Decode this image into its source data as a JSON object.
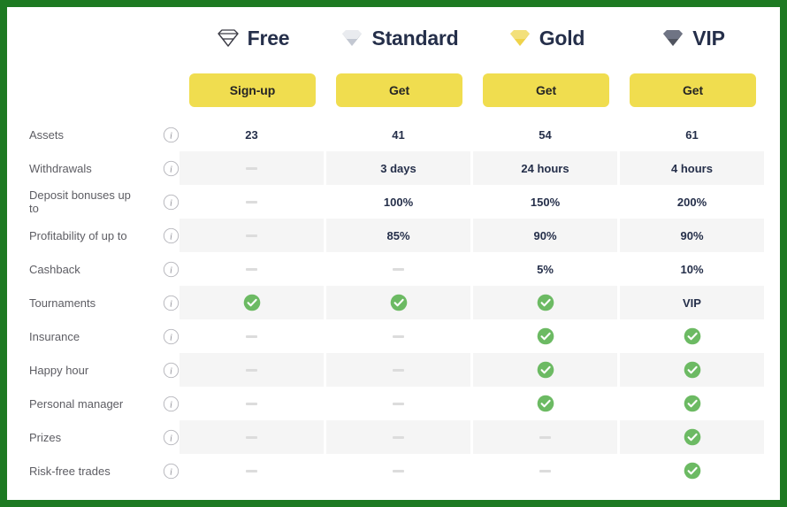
{
  "colors": {
    "frame_border": "#1d7a22",
    "button": "#f0dd4f",
    "check": "#6cba63",
    "stripe": "#f5f5f5",
    "heading_text": "#252f4a",
    "label_text": "#5d5d63"
  },
  "plans": [
    {
      "name": "Free",
      "icon": "gem-outline-icon",
      "cta": "Sign-up"
    },
    {
      "name": "Standard",
      "icon": "gem-silver-icon",
      "cta": "Get"
    },
    {
      "name": "Gold",
      "icon": "gem-gold-icon",
      "cta": "Get"
    },
    {
      "name": "VIP",
      "icon": "gem-black-icon",
      "cta": "Get"
    }
  ],
  "info_icon": "info-circle-icon",
  "rows": [
    {
      "label": "Assets",
      "striped": false,
      "values": [
        "23",
        "41",
        "54",
        "61"
      ],
      "types": [
        "text",
        "text",
        "text",
        "text"
      ]
    },
    {
      "label": "Withdrawals",
      "striped": true,
      "values": [
        "",
        "3 days",
        "24 hours",
        "4 hours"
      ],
      "types": [
        "dash",
        "text",
        "text",
        "text"
      ]
    },
    {
      "label": "Deposit bonuses up to",
      "striped": false,
      "values": [
        "",
        "100%",
        "150%",
        "200%"
      ],
      "types": [
        "dash",
        "text",
        "text",
        "text"
      ]
    },
    {
      "label": "Profitability of up to",
      "striped": true,
      "values": [
        "",
        "85%",
        "90%",
        "90%"
      ],
      "types": [
        "dash",
        "text",
        "text",
        "text"
      ]
    },
    {
      "label": "Cashback",
      "striped": false,
      "values": [
        "",
        "",
        "5%",
        "10%"
      ],
      "types": [
        "dash",
        "dash",
        "text",
        "text"
      ]
    },
    {
      "label": "Tournaments",
      "striped": true,
      "values": [
        "",
        "",
        "",
        "VIP"
      ],
      "types": [
        "check",
        "check",
        "check",
        "text"
      ]
    },
    {
      "label": "Insurance",
      "striped": false,
      "values": [
        "",
        "",
        "",
        ""
      ],
      "types": [
        "dash",
        "dash",
        "check",
        "check"
      ]
    },
    {
      "label": "Happy hour",
      "striped": true,
      "values": [
        "",
        "",
        "",
        ""
      ],
      "types": [
        "dash",
        "dash",
        "check",
        "check"
      ]
    },
    {
      "label": "Personal manager",
      "striped": false,
      "values": [
        "",
        "",
        "",
        ""
      ],
      "types": [
        "dash",
        "dash",
        "check",
        "check"
      ]
    },
    {
      "label": "Prizes",
      "striped": true,
      "values": [
        "",
        "",
        "",
        ""
      ],
      "types": [
        "dash",
        "dash",
        "dash",
        "check"
      ]
    },
    {
      "label": "Risk-free trades",
      "striped": false,
      "values": [
        "",
        "",
        "",
        ""
      ],
      "types": [
        "dash",
        "dash",
        "dash",
        "check"
      ]
    }
  ]
}
